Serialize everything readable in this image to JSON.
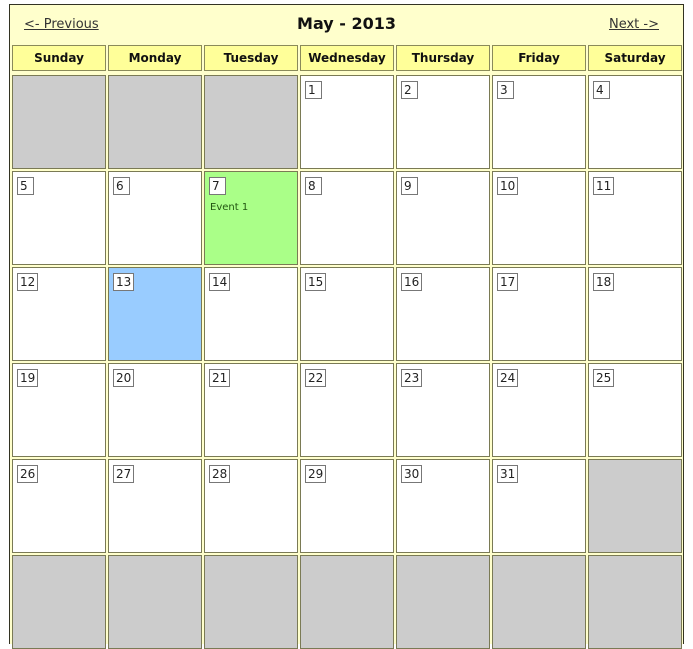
{
  "header": {
    "prev_label": "<- Previous",
    "title": "May - 2013",
    "next_label": "Next ->"
  },
  "day_names": [
    "Sunday",
    "Monday",
    "Tuesday",
    "Wednesday",
    "Thursday",
    "Friday",
    "Saturday"
  ],
  "colors": {
    "empty": "#cccccc",
    "event": "#aaff88",
    "today": "#99ccff",
    "header_bg": "#ffffcc",
    "dayname_bg": "#ffff99"
  },
  "weeks": [
    [
      {
        "day": null
      },
      {
        "day": null
      },
      {
        "day": null
      },
      {
        "day": "1"
      },
      {
        "day": "2"
      },
      {
        "day": "3"
      },
      {
        "day": "4"
      }
    ],
    [
      {
        "day": "5"
      },
      {
        "day": "6"
      },
      {
        "day": "7",
        "event": "Event 1"
      },
      {
        "day": "8"
      },
      {
        "day": "9"
      },
      {
        "day": "10"
      },
      {
        "day": "11"
      }
    ],
    [
      {
        "day": "12"
      },
      {
        "day": "13",
        "today": true
      },
      {
        "day": "14"
      },
      {
        "day": "15"
      },
      {
        "day": "16"
      },
      {
        "day": "17"
      },
      {
        "day": "18"
      }
    ],
    [
      {
        "day": "19"
      },
      {
        "day": "20"
      },
      {
        "day": "21"
      },
      {
        "day": "22"
      },
      {
        "day": "23"
      },
      {
        "day": "24"
      },
      {
        "day": "25"
      }
    ],
    [
      {
        "day": "26"
      },
      {
        "day": "27"
      },
      {
        "day": "28"
      },
      {
        "day": "29"
      },
      {
        "day": "30"
      },
      {
        "day": "31"
      },
      {
        "day": null
      }
    ],
    [
      {
        "day": null
      },
      {
        "day": null
      },
      {
        "day": null
      },
      {
        "day": null
      },
      {
        "day": null
      },
      {
        "day": null
      },
      {
        "day": null
      }
    ]
  ]
}
